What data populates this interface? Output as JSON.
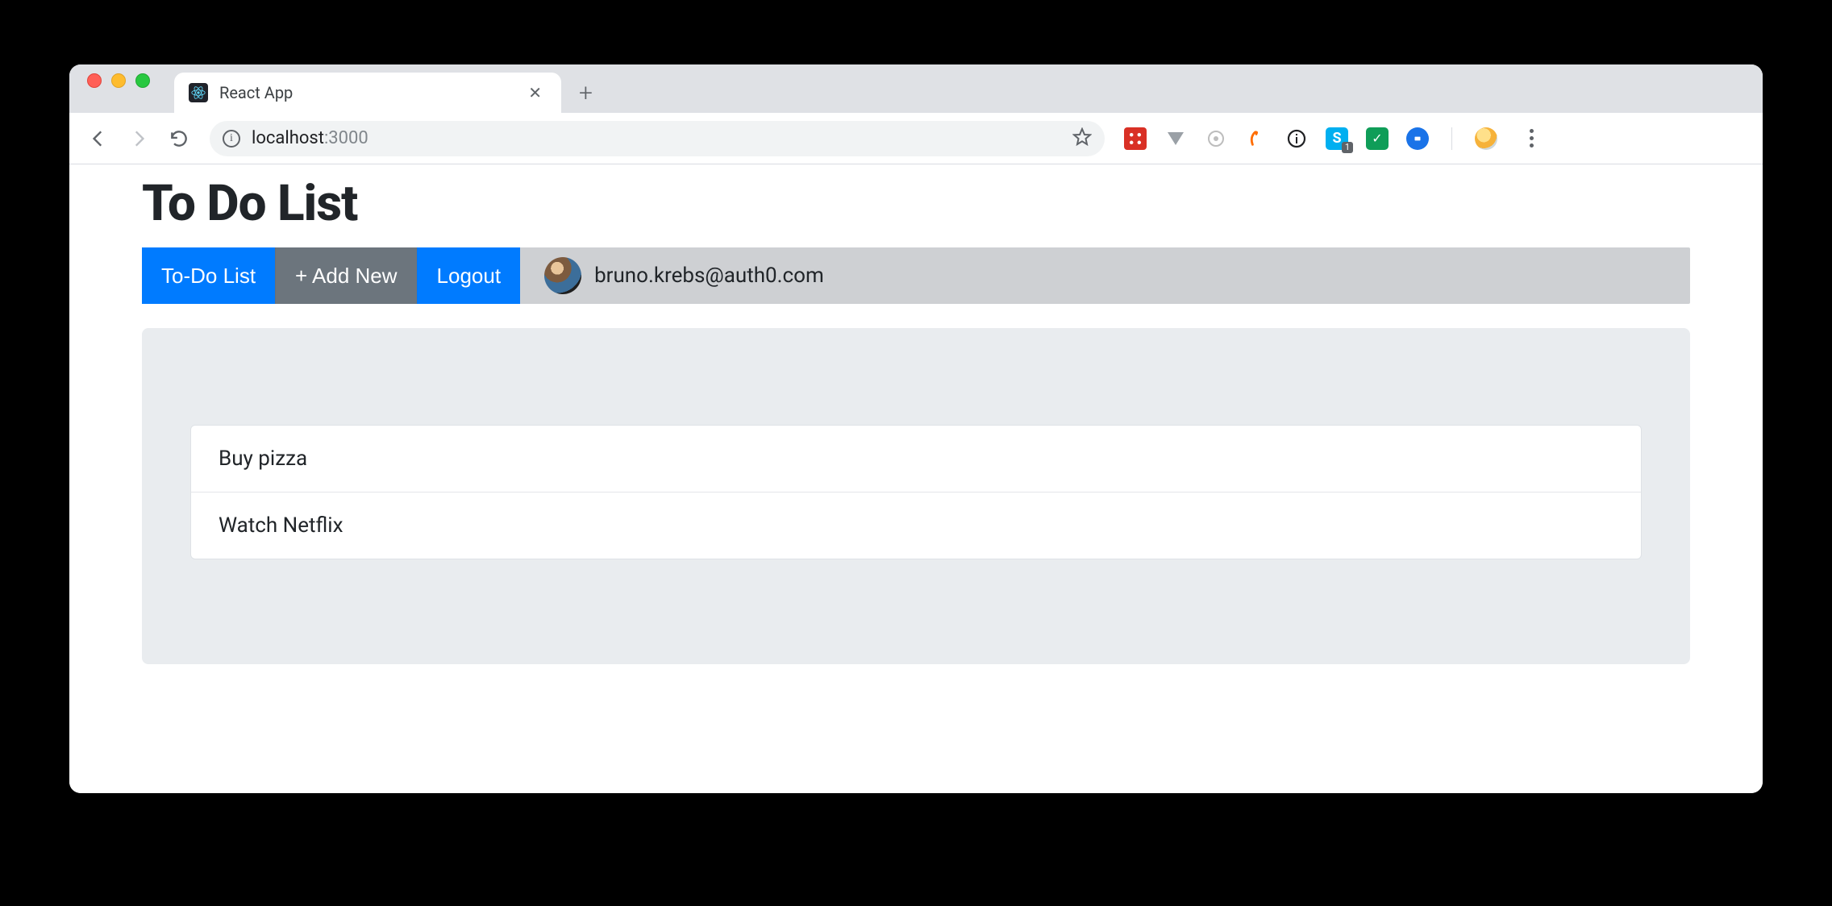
{
  "browser": {
    "tab_title": "React App",
    "url_host": "localhost",
    "url_port": ":3000",
    "skype_badge": "1"
  },
  "page": {
    "heading": "To Do List",
    "nav": {
      "todo": "To-Do List",
      "add": "+ Add New",
      "logout": "Logout"
    },
    "user_email": "bruno.krebs@auth0.com",
    "items": [
      "Buy pizza",
      "Watch Netflix"
    ]
  }
}
